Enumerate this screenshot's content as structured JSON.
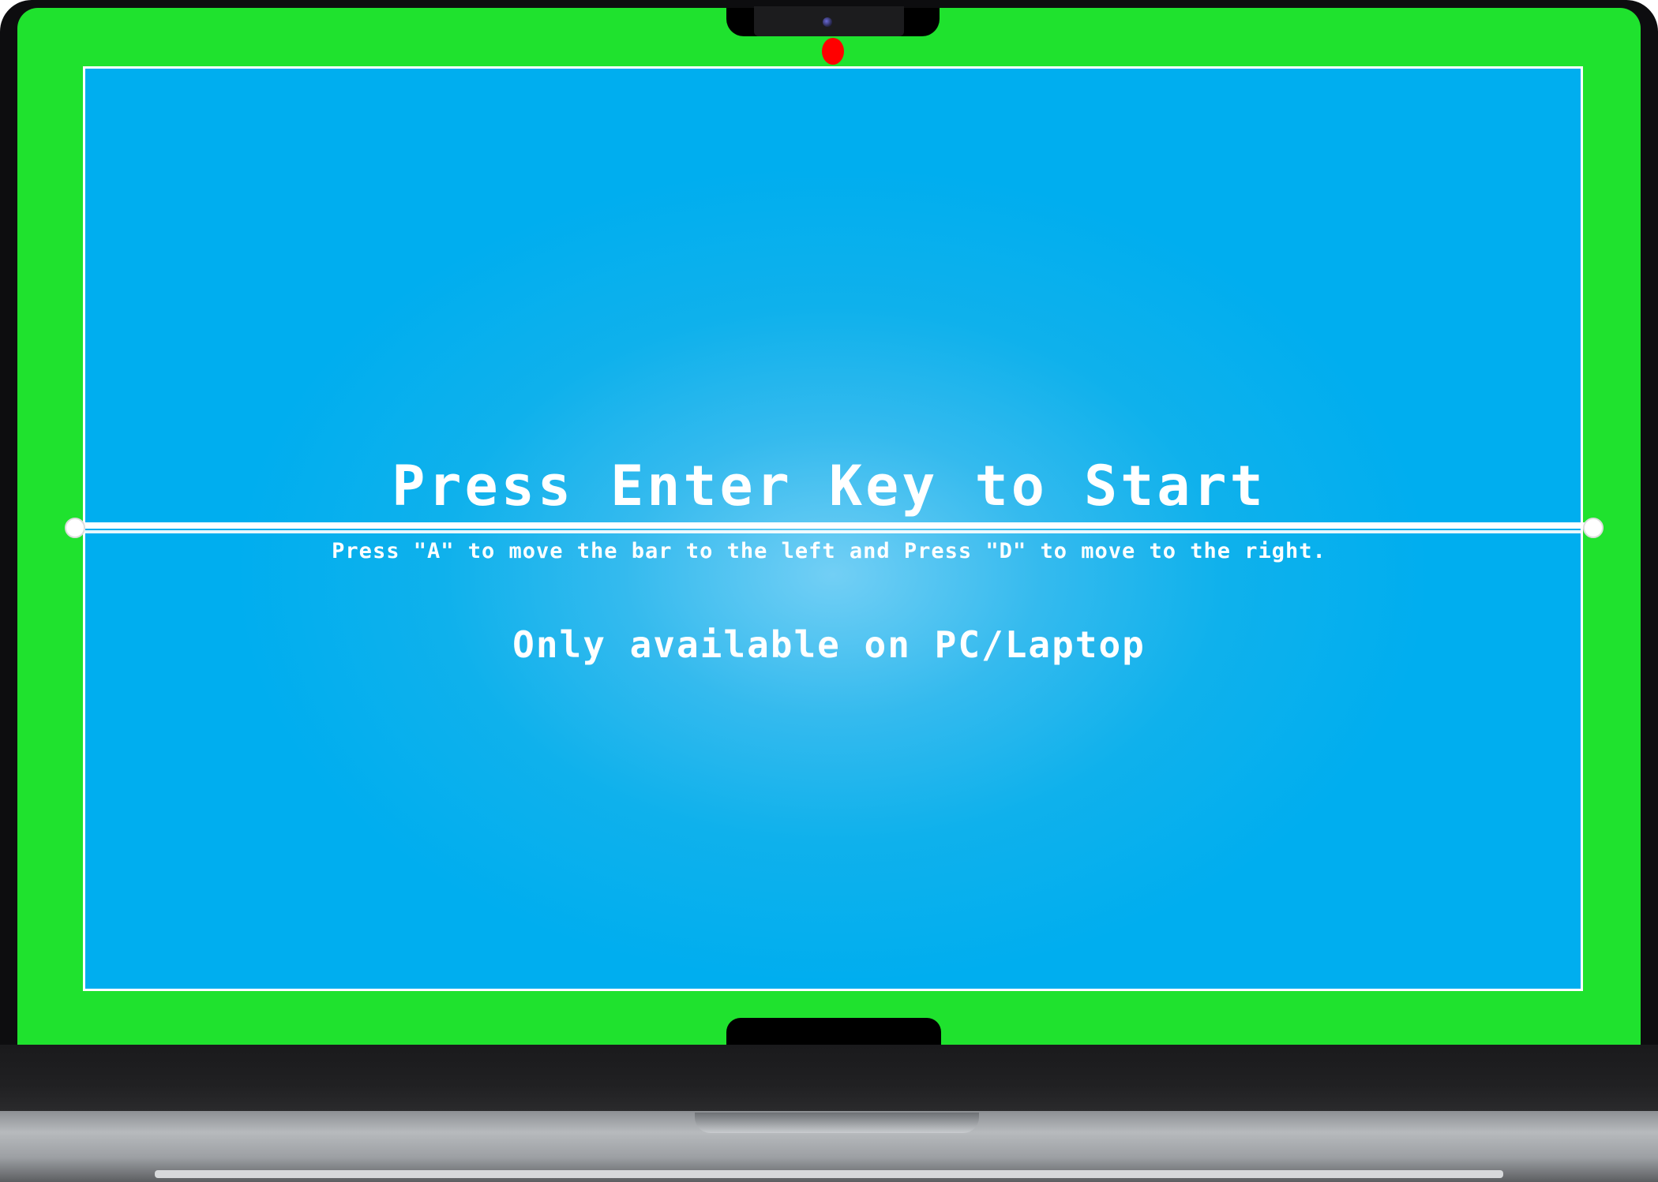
{
  "game": {
    "title": "Press Enter Key to Start",
    "instructions": "Press \"A\" to move the bar to the left and Press \"D\" to move to the right.",
    "availability": "Only available on PC/Laptop"
  },
  "colors": {
    "screen_background": "#1fe22e",
    "field_background": "#00aeef",
    "ball": "#ff0000",
    "text": "#ffffff",
    "bar": "#ffffff"
  },
  "icons": {
    "camera": "camera-icon"
  }
}
